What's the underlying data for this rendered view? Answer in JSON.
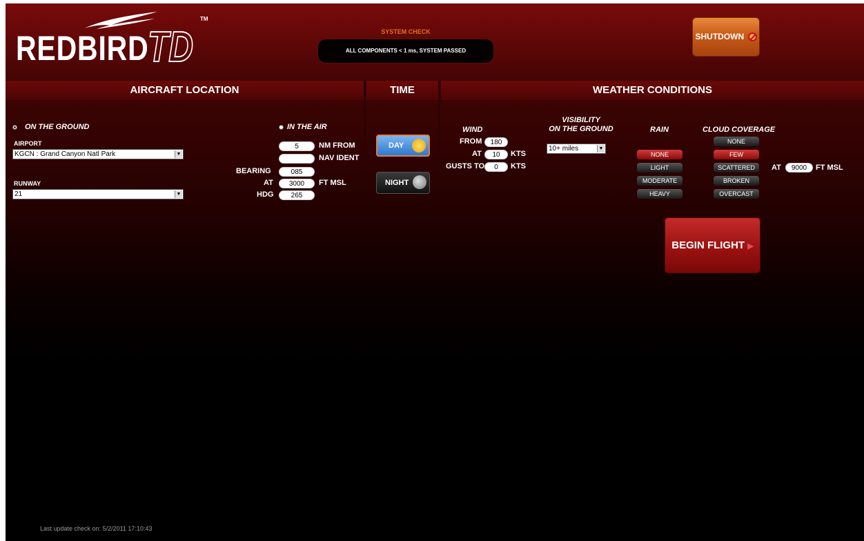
{
  "brand": {
    "name": "REDBIRD",
    "suffix": "TD",
    "tm": "TM"
  },
  "system_check": {
    "label": "SYSTEM CHECK",
    "status": "ALL COMPONENTS < 1 ms, SYSTEM PASSED"
  },
  "shutdown_label": "SHUTDOWN",
  "sections": {
    "location": "AIRCRAFT LOCATION",
    "time": "TIME",
    "weather": "WEATHER CONDITIONS"
  },
  "location": {
    "on_ground": "ON THE GROUND",
    "airport_label": "AIRPORT",
    "airport_value": "KGCN : Grand Canyon Natl Park",
    "runway_label": "RUNWAY",
    "runway_value": "21",
    "in_air": "IN THE AIR",
    "nm_value": "5",
    "nm_label": "NM FROM",
    "nav_value": "",
    "nav_label": "NAV IDENT",
    "bearing_label": "BEARING",
    "bearing_value": "085",
    "at_label": "AT",
    "alt_value": "3000",
    "alt_unit": "FT MSL",
    "hdg_label": "HDG",
    "hdg_value": "265"
  },
  "time": {
    "day": "DAY",
    "night": "NIGHT"
  },
  "weather": {
    "wind_label": "WIND",
    "from_label": "FROM",
    "from_value": "180",
    "at_label": "AT",
    "speed_value": "10",
    "kts": "KTS",
    "gusts_label": "GUSTS TO",
    "gusts_value": "0",
    "visibility_label_1": "VISIBILITY",
    "visibility_label_2": "ON THE GROUND",
    "visibility_value": "10+ miles",
    "rain_label": "RAIN",
    "rain_options": [
      "NONE",
      "LIGHT",
      "MODERATE",
      "HEAVY"
    ],
    "cloud_label": "CLOUD COVERAGE",
    "cloud_options": [
      "NONE",
      "FEW",
      "SCATTERED",
      "BROKEN",
      "OVERCAST"
    ],
    "cloud_at_label": "AT",
    "cloud_alt_value": "9000",
    "cloud_alt_unit": "FT MSL"
  },
  "begin_label": "BEGIN FLIGHT",
  "footer": "Last update check on: 5/2/2011 17:10:43",
  "colors": {
    "accent_red": "#c42a2a",
    "shutdown_orange": "#e07020",
    "selected_option": "#d23a3a"
  }
}
